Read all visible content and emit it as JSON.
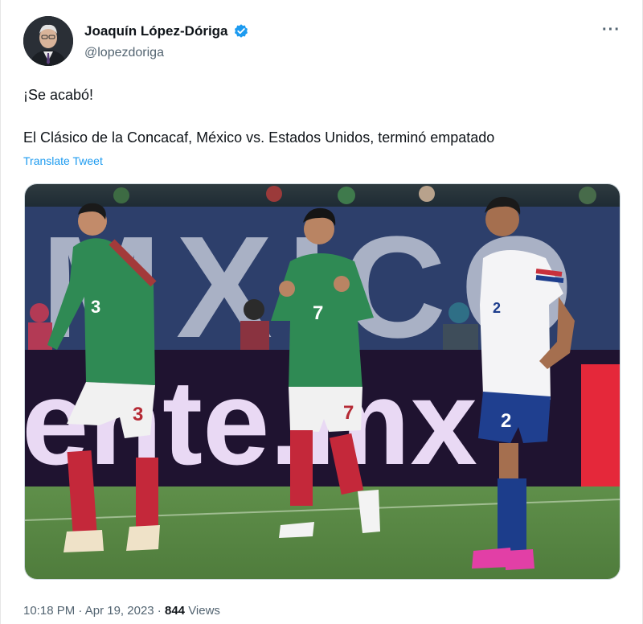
{
  "author": {
    "name": "Joaquín López-Dóriga",
    "handle": "@lopezdoriga",
    "verified_icon": "verified-badge-icon"
  },
  "tweet": {
    "line1": "¡Se acabó!",
    "line2": "El Clásico de la Concacaf, México vs. Estados Unidos, terminó empatado",
    "translate_label": "Translate Tweet"
  },
  "media": {
    "banner_text": "ente.mx",
    "jersey_numbers": [
      "3",
      "7",
      "2"
    ],
    "shorts_numbers": [
      "3",
      "7",
      "2"
    ]
  },
  "meta": {
    "time": "10:18 PM",
    "separator": " · ",
    "date": "Apr 19, 2023",
    "views_count": "844",
    "views_label": "Views"
  },
  "colors": {
    "link": "#1d9bf0",
    "verified": "#1d9bf0",
    "muted": "#536471",
    "text": "#0f1419"
  }
}
